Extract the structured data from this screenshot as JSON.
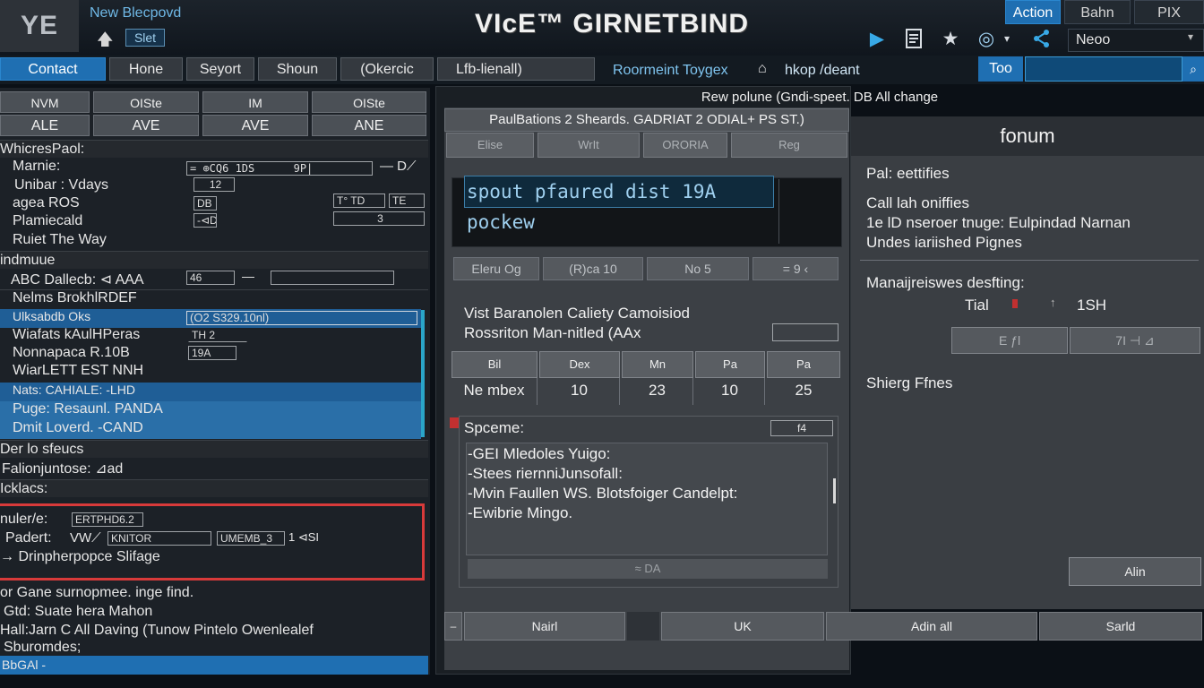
{
  "header": {
    "logo": "YE",
    "doc_name": "New Blecpovd",
    "sel_label": "Slet",
    "app_title": "VIcE™ GIRNETBIND",
    "tabs": [
      "Action",
      "Bahn",
      "PIX"
    ],
    "user_select": "Neoo",
    "icons": [
      "play-icon",
      "document-icon",
      "star-icon",
      "target-icon",
      "share-icon"
    ]
  },
  "menu": {
    "tabs": [
      "Contact",
      "Hone",
      "Seyort",
      "Shoun",
      "(Okercic",
      "Lfb-lienall)"
    ],
    "location": "Roormeint Toygex",
    "path": "hkop /deant",
    "too_label": "Too",
    "too_value": ""
  },
  "left": {
    "headers_row1": [
      "NVM",
      "OISte",
      "IM",
      "OISte"
    ],
    "headers_row2": [
      "ALE",
      "AVE",
      "AVE",
      "ANE"
    ],
    "section1_title": "WhicresPaol:",
    "fields": [
      {
        "label": "Marnie:",
        "box1": "= ⊕CQ6 1DS",
        "box2": "9P|",
        "extra": "— D⟋"
      },
      {
        "label": "Unibar : Vdays",
        "box1": "12"
      },
      {
        "label": "agea ROS",
        "box1": "DB",
        "box2": "T° TD",
        "box3": "TE"
      },
      {
        "label": "Plamiecald",
        "box1": "-⊲D",
        "box2": "3"
      },
      {
        "label": "Ruiet  The Way"
      }
    ],
    "section2_title": "indmuue",
    "abc_row": {
      "label": "ABC Dallecb: ⊲ AAA",
      "box1": "46",
      "box2": ""
    },
    "rows": [
      {
        "text": "Nelms BrokhlRDEF",
        "hi": false
      },
      {
        "text": "Ulksabdb Oks",
        "value": "(O2 S329.10nl)",
        "hi": true
      },
      {
        "text": "Wiafats  kAulHPeras",
        "value": "TH 2",
        "hi": false
      },
      {
        "text": "Nonnapaca R.10B",
        "value": "19A",
        "hi": false
      },
      {
        "text": "WiarLETT EST NNH",
        "hi": false
      },
      {
        "text": "Nats: CAHIALE: -LHD",
        "hi": true
      },
      {
        "text": "Puge:  Resaunl. PANDA",
        "hi": true
      },
      {
        "text": "Dmit Loverd. -CAND",
        "hi": true
      }
    ],
    "section3_title": "Der lo sfeucs",
    "fal_row": "Falionjuntose: ⊿ad",
    "section4_title": "Icklacs:",
    "red_box": {
      "line1_label": "nuler/e:",
      "line1_box": "ERTPHD6.2",
      "line2_label": "Padert:",
      "line2_val": "VW⟋",
      "line2_box1": "KNITOR",
      "line2_box2": "UMEMB_3",
      "line2_tail": "1 ⊲SI",
      "line3": "→ Drinpherpopce  Slifage"
    },
    "footer_lines": [
      "or Gane surnopmee. inge  find.",
      "Gtd: Suate hera  Mahon",
      "Hall:Jarn C All Daving (Tunow  Pintelo  Owenlealef",
      "Sburomdes;"
    ],
    "status": "BbGAl -"
  },
  "center": {
    "title": "Rew polune (Gndi-speet. DB All change",
    "header": "PaulBations  2 Sheards. GADRIAT 2 ODIAL+ PS ST.)",
    "segments": [
      "Elise",
      "WrIt",
      "ORORIA",
      "Reg"
    ],
    "terminal_text": "spout pfaured dist 19A pockew",
    "filters": [
      "Eleru Og",
      "(R)ca 10",
      "No 5",
      "= 9 ‹"
    ],
    "line1": "Vist Baranolen Caliety Camoisiod",
    "line2": "Rossriton Man-nitled (AAx",
    "table_headers": [
      "Bil",
      "Dex",
      "Mn",
      "Pa",
      "Pa"
    ],
    "table_row": [
      "Ne mbex",
      "10",
      "23",
      "10",
      "25"
    ],
    "spec_title": "Spceme:",
    "spec_field": "f4",
    "spec_lines": [
      "-GEI Mledoles  Yuigo:",
      "-Stees riernniJunsofall:",
      "-Mvin Faullen WS.  Blotsfoiger Candelpt:",
      "-Ewibrie  Mingo."
    ],
    "spec_footer": "≈ DA",
    "bottom_buttons": [
      "Nairl",
      "UK",
      "Adin all",
      "Sarld"
    ]
  },
  "right": {
    "header": "fonum",
    "lines": [
      "Pal: eettifies",
      "Call lah oniffies",
      "1e lD nseroer  tnuge:  Eulpindad Narnan",
      "Undes iariished Pignes",
      "Manaijreiswes desfting:",
      "Tial",
      "1SH",
      "Shierg  Ffnes"
    ],
    "tial_mid": "↑",
    "segments": [
      "E  ƒl",
      "7I ⊣ ⊿"
    ],
    "alin_button": "Alin"
  }
}
